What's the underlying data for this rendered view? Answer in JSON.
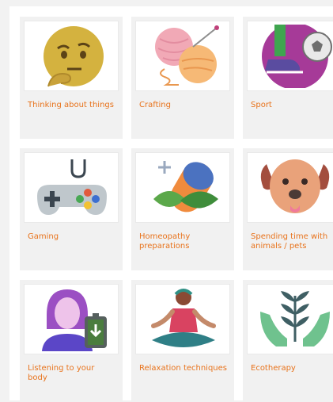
{
  "cards": [
    {
      "label": "Thinking about things",
      "icon": "thinking-face-icon"
    },
    {
      "label": "Crafting",
      "icon": "yarn-ball-icon"
    },
    {
      "label": "Sport",
      "icon": "soccer-icon"
    },
    {
      "label": "Gaming",
      "icon": "game-controller-icon"
    },
    {
      "label": "Homeopathy preparations",
      "icon": "herbal-capsule-icon"
    },
    {
      "label": "Spending time with animals / pets",
      "icon": "dog-face-icon"
    },
    {
      "label": "Listening to your body",
      "icon": "person-battery-icon"
    },
    {
      "label": "Relaxation techniques",
      "icon": "meditation-icon"
    },
    {
      "label": "Ecotherapy",
      "icon": "plant-hands-icon"
    }
  ],
  "colors": {
    "label": "#e8731c",
    "card_bg": "#f1f1f1"
  }
}
